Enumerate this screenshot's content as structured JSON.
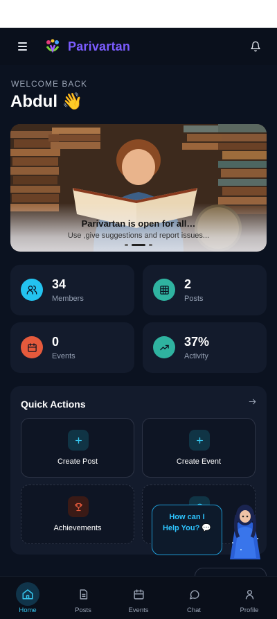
{
  "app": {
    "title": "Parivartan"
  },
  "welcome": {
    "label": "WELCOME BACK",
    "name": "Abdul 👋"
  },
  "banner": {
    "title": "Parivartan is open for all…",
    "subtitle": "Use ,give suggestions and report issues...",
    "slides": 3,
    "active_slide": 2
  },
  "stats": [
    {
      "value": "34",
      "label": "Members",
      "icon": "users-icon",
      "color": "#23c3f0"
    },
    {
      "value": "2",
      "label": "Posts",
      "icon": "grid-icon",
      "color": "#2fb3a0"
    },
    {
      "value": "0",
      "label": "Events",
      "icon": "calendar-icon",
      "color": "#e55a3c"
    },
    {
      "value": "37%",
      "label": "Activity",
      "icon": "trending-up-icon",
      "color": "#2fb3a0"
    }
  ],
  "quick_actions": {
    "title": "Quick Actions",
    "items": [
      {
        "label": "Create Post",
        "icon": "plus-icon"
      },
      {
        "label": "Create Event",
        "icon": "plus-icon"
      },
      {
        "label": "Achievements",
        "icon": "trophy-icon"
      },
      {
        "label": "",
        "icon": "circle-icon"
      }
    ]
  },
  "chat": {
    "prompt": "How can I Help You? 💬"
  },
  "nav": [
    {
      "label": "Home",
      "icon": "home-icon",
      "active": true
    },
    {
      "label": "Posts",
      "icon": "document-icon",
      "active": false
    },
    {
      "label": "Events",
      "icon": "calendar-icon",
      "active": false
    },
    {
      "label": "Chat",
      "icon": "chat-icon",
      "active": false
    },
    {
      "label": "Profile",
      "icon": "user-icon",
      "active": false
    }
  ],
  "colors": {
    "accent": "#7b5cff",
    "active_nav": "#36c7f0",
    "background": "#0b1220",
    "card": "#131b2c"
  }
}
